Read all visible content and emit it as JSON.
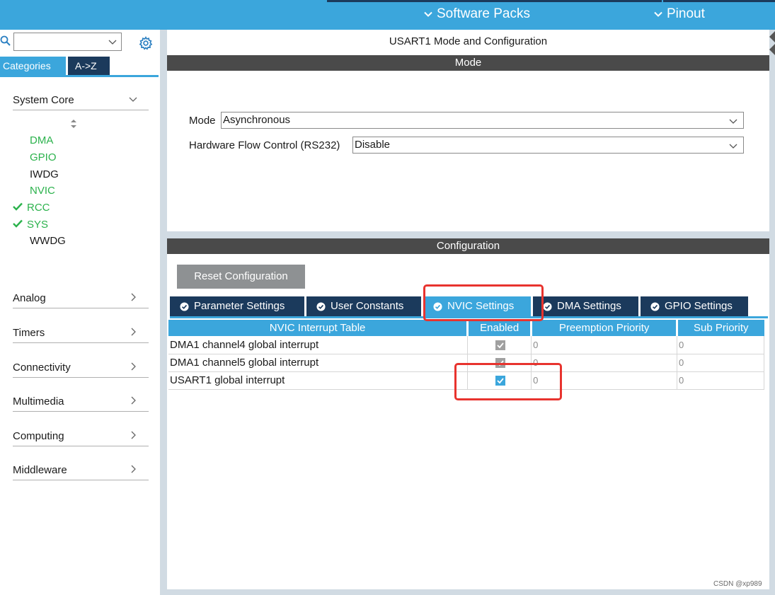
{
  "topbar": {
    "software_packs_label": "Software Packs",
    "pinout_label": "Pinout"
  },
  "left": {
    "search_value": "",
    "tabs": {
      "categories": "Categories",
      "az": "A->Z"
    },
    "groups": {
      "system_core": "System Core",
      "analog": "Analog",
      "timers": "Timers",
      "connectivity": "Connectivity",
      "multimedia": "Multimedia",
      "computing": "Computing",
      "middleware": "Middleware"
    },
    "peripherals": [
      {
        "label": "DMA",
        "color": "#2bb24c",
        "checked": false
      },
      {
        "label": "GPIO",
        "color": "#2bb24c",
        "checked": false
      },
      {
        "label": "IWDG",
        "color": "#1a1a1a",
        "checked": false
      },
      {
        "label": "NVIC",
        "color": "#2bb24c",
        "checked": false
      },
      {
        "label": "RCC",
        "color": "#2bb24c",
        "checked": true
      },
      {
        "label": "SYS",
        "color": "#2bb24c",
        "checked": true
      },
      {
        "label": "WWDG",
        "color": "#1a1a1a",
        "checked": false
      }
    ]
  },
  "main": {
    "title": "USART1 Mode and Configuration",
    "mode_header": "Mode",
    "mode_label": "Mode",
    "mode_value": "Asynchronous",
    "hwflow_label": "Hardware Flow Control (RS232)",
    "hwflow_value": "Disable",
    "config_header": "Configuration",
    "reset_label": "Reset Configuration",
    "tabs": {
      "parameter": "Parameter Settings",
      "user_constants": "User Constants",
      "nvic": "NVIC Settings",
      "dma": "DMA Settings",
      "gpio": "GPIO Settings"
    },
    "table": {
      "headers": [
        "NVIC Interrupt Table",
        "Enabled",
        "Preemption Priority",
        "Sub Priority"
      ],
      "rows": [
        {
          "name": "DMA1 channel4 global interrupt",
          "enabled": true,
          "locked": true,
          "preemption": "0",
          "sub": "0"
        },
        {
          "name": "DMA1 channel5 global interrupt",
          "enabled": true,
          "locked": true,
          "preemption": "0",
          "sub": "0"
        },
        {
          "name": "USART1 global interrupt",
          "enabled": true,
          "locked": false,
          "preemption": "0",
          "sub": "0"
        }
      ]
    }
  },
  "watermark": "CSDN @xp989",
  "colors": {
    "accent": "#3ba6dc",
    "dark_navy": "#1b3a5c",
    "section_header": "#4a4a4a",
    "highlight_red": "#e8332e",
    "enabled_green": "#2bb24c"
  }
}
